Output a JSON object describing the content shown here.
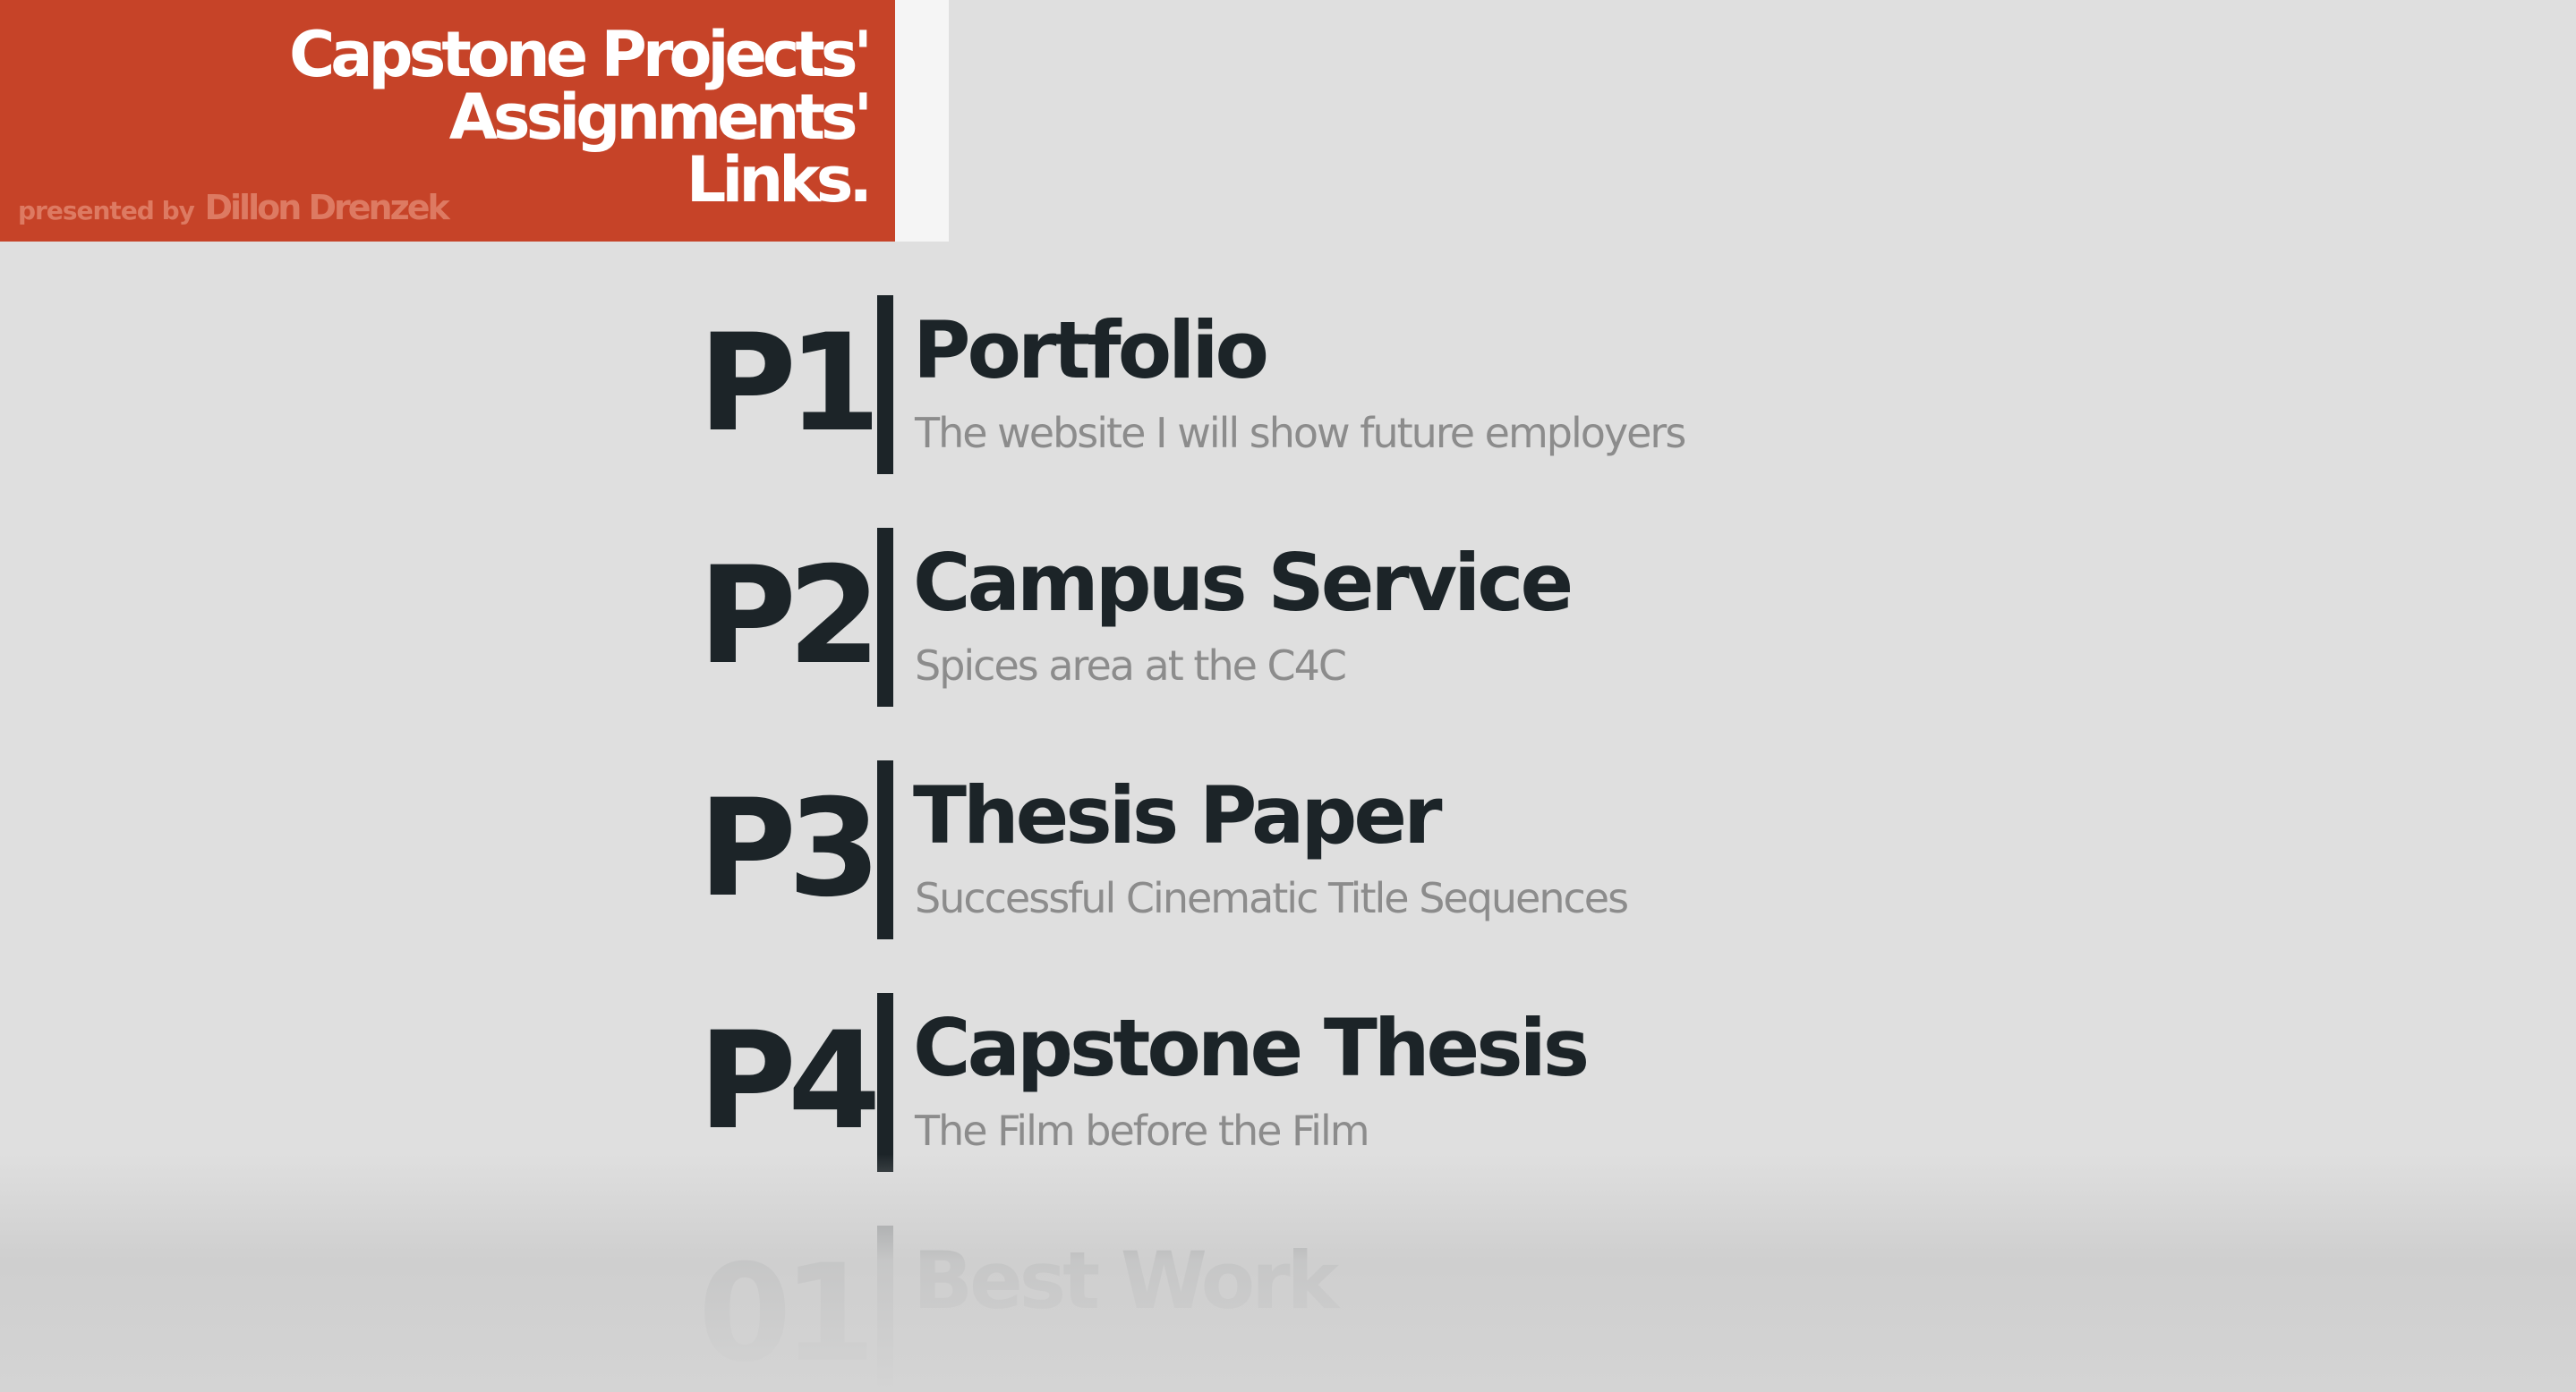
{
  "header": {
    "title_line1": "Capstone Projects'",
    "title_line2": "Assignments'",
    "title_line3": "Links.",
    "presented_by": "presented by",
    "author": "Dillon Drenzek",
    "bg_color": "#c64328"
  },
  "projects": [
    {
      "code": "P1",
      "title": "Portfolio",
      "subtitle": "The website I will show future employers"
    },
    {
      "code": "P2",
      "title": "Campus Service",
      "subtitle": "Spices area at the C4C"
    },
    {
      "code": "P3",
      "title": "Thesis Paper",
      "subtitle": "Successful Cinematic Title Sequences"
    },
    {
      "code": "P4",
      "title": "Capstone Thesis",
      "subtitle": "The Film before the Film"
    },
    {
      "code": "01",
      "title": "Best Work",
      "subtitle": ""
    }
  ],
  "colors": {
    "text_dark": "#1c2428",
    "text_muted": "#8c8c8c",
    "background": "#dfdfdf"
  }
}
